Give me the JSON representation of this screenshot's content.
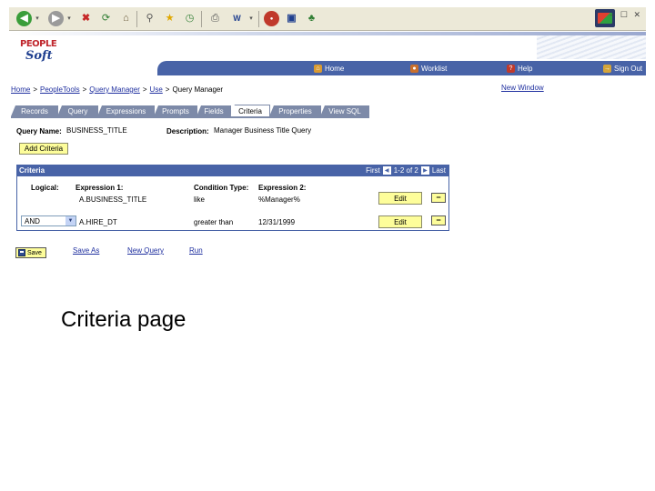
{
  "browser": {
    "toolbar_icons": [
      "back-icon",
      "forward-icon",
      "stop-icon",
      "refresh-icon",
      "home-icon",
      "search-icon",
      "favorites-icon",
      "history-icon",
      "print-icon",
      "edit-icon",
      "discuss-icon",
      "messenger-icon"
    ],
    "window_controls": "– ☐ ✕"
  },
  "header": {
    "logo_line1": "PEOPLE",
    "logo_line2": "Soft",
    "nav": [
      {
        "label": "Home",
        "icon": "home-icon",
        "color": "#d99a32"
      },
      {
        "label": "Worklist",
        "icon": "worklist-icon",
        "color": "#c96f2c"
      },
      {
        "label": "Help",
        "icon": "help-icon",
        "color": "#c0392b"
      },
      {
        "label": "Sign Out",
        "icon": "signout-icon",
        "color": "#d4a43a"
      }
    ]
  },
  "breadcrumb": {
    "items": [
      "Home",
      "PeopleTools",
      "Query Manager",
      "Use"
    ],
    "current": "Query Manager",
    "separator": ">"
  },
  "new_window": "New Window",
  "tabs": [
    {
      "label": "Records",
      "active": false
    },
    {
      "label": "Query",
      "active": false
    },
    {
      "label": "Expressions",
      "active": false
    },
    {
      "label": "Prompts",
      "active": false
    },
    {
      "label": "Fields",
      "active": false
    },
    {
      "label": "Criteria",
      "active": true
    },
    {
      "label": "Properties",
      "active": false
    },
    {
      "label": "View SQL",
      "active": false
    }
  ],
  "query": {
    "name_label": "Query Name:",
    "name_value": "BUSINESS_TITLE",
    "desc_label": "Description:",
    "desc_value": "Manager Business Title Query"
  },
  "add_criteria": "Add Criteria",
  "criteria": {
    "title": "Criteria",
    "pager": {
      "first": "First",
      "range": "1-2 of 2",
      "last": "Last"
    },
    "columns": [
      "Logical:",
      "Expression 1:",
      "Condition Type:",
      "Expression 2:"
    ],
    "rows": [
      {
        "logical": "",
        "expr1": "A.BUSINESS_TITLE",
        "condition": "like",
        "expr2": "%Manager%",
        "edit": "Edit",
        "delete": "−"
      },
      {
        "logical": "AND",
        "expr1": "A.HIRE_DT",
        "condition": "greater than",
        "expr2": "12/31/1999",
        "edit": "Edit",
        "delete": "−"
      }
    ]
  },
  "actions": {
    "save": "Save",
    "save_as": "Save As",
    "new_query": "New Query",
    "run": "Run"
  },
  "caption": "Criteria page",
  "colors": {
    "nav_blue": "#4863a7",
    "tab_gray": "#7d8aa8",
    "button_yellow": "#fdfd9a",
    "link_blue": "#1f2f9f",
    "logo_red": "#c0262d"
  }
}
